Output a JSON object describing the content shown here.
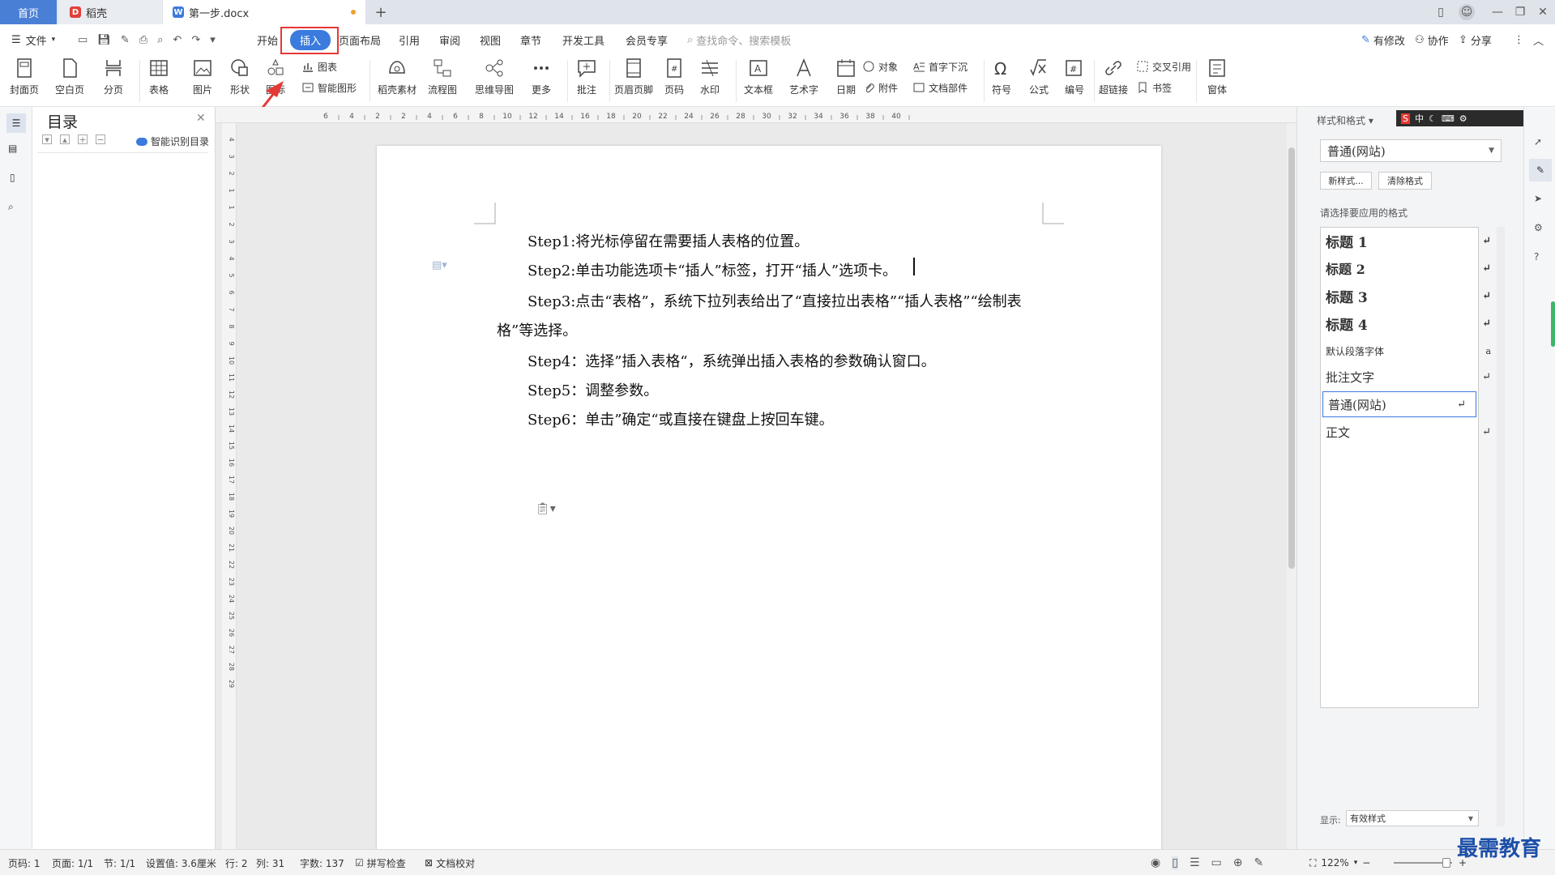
{
  "titlebar": {
    "tabs": [
      {
        "label": "首页"
      },
      {
        "label": "稻壳"
      },
      {
        "label": "第一步.docx"
      }
    ],
    "new_tab": "+",
    "modified_dot_color": "#f0a030"
  },
  "menubar": {
    "file": "文件",
    "tabs": [
      "开始",
      "插入",
      "页面布局",
      "引用",
      "审阅",
      "视图",
      "章节",
      "开发工具",
      "会员专享"
    ],
    "active_tab": "插入",
    "search_placeholder": "查找命令、搜索模板",
    "right": [
      "有修改",
      "协作",
      "分享"
    ]
  },
  "ribbon": {
    "items": [
      "封面页",
      "空白页",
      "分页",
      "表格",
      "图片",
      "形状",
      "图标",
      "图表",
      "智能图形",
      "稻壳素材",
      "流程图",
      "思维导图",
      "更多",
      "批注",
      "页眉页脚",
      "页码",
      "水印",
      "文本框",
      "艺术字",
      "日期",
      "对象",
      "附件",
      "首字下沉",
      "文档部件",
      "符号",
      "公式",
      "编号",
      "超链接",
      "交叉引用",
      "书签",
      "窗体"
    ]
  },
  "toc": {
    "title": "目录",
    "smart": "智能识别目录"
  },
  "document": {
    "paragraphs": [
      "Step1:将光标停留在需要插人表格的位置。",
      "Step2:单击功能选项卡“插人”标签，打开“插人”选项卡。",
      "Step3:点击“表格”，系统下拉列表给出了“直接拉出表格”“插人表格”“绘制表",
      "格”等选择。",
      "Step4：选择”插入表格“，系统弹出插入表格的参数确认窗口。",
      "Step5：调整参数。",
      "Step6：单击”确定“或直接在键盘上按回车键。"
    ],
    "ruler_top": [
      "6",
      "4",
      "2",
      "2",
      "4",
      "6",
      "8",
      "10",
      "12",
      "14",
      "16",
      "18",
      "20",
      "22",
      "24",
      "26",
      "28",
      "30",
      "32",
      "34",
      "36",
      "38",
      "40"
    ],
    "ruler_left": [
      "4",
      "3",
      "2",
      "1",
      "1",
      "2",
      "3",
      "4",
      "5",
      "6",
      "7",
      "8",
      "9",
      "10",
      "11",
      "12",
      "13",
      "14",
      "15",
      "16",
      "17",
      "18",
      "19",
      "20",
      "21",
      "22",
      "23",
      "24",
      "25",
      "26",
      "27",
      "28",
      "29"
    ]
  },
  "stylepanel": {
    "header": "样式和格式",
    "current": "普通(网站)",
    "new_style": "新样式...",
    "clear_format": "清除格式",
    "prompt": "请选择要应用的格式",
    "styles": [
      "标题 1",
      "标题 2",
      "标题 3",
      "标题 4",
      "默认段落字体",
      "批注文字",
      "普通(网站)",
      "正文"
    ],
    "show_label": "显示:",
    "show_value": "有效样式"
  },
  "statusbar": {
    "page_num": "页码: 1",
    "pages": "页面: 1/1",
    "section": "节: 1/1",
    "setting": "设置值: 3.6厘米",
    "row": "行: 2",
    "col": "列: 31",
    "words": "字数: 137",
    "spell": "拼写检查",
    "proofread": "文档校对",
    "zoom": "122%"
  },
  "watermark": "最需教育",
  "colors": {
    "accent": "#3a7bdd",
    "highlight_box": "#e53935",
    "arrow": "#e53935"
  }
}
